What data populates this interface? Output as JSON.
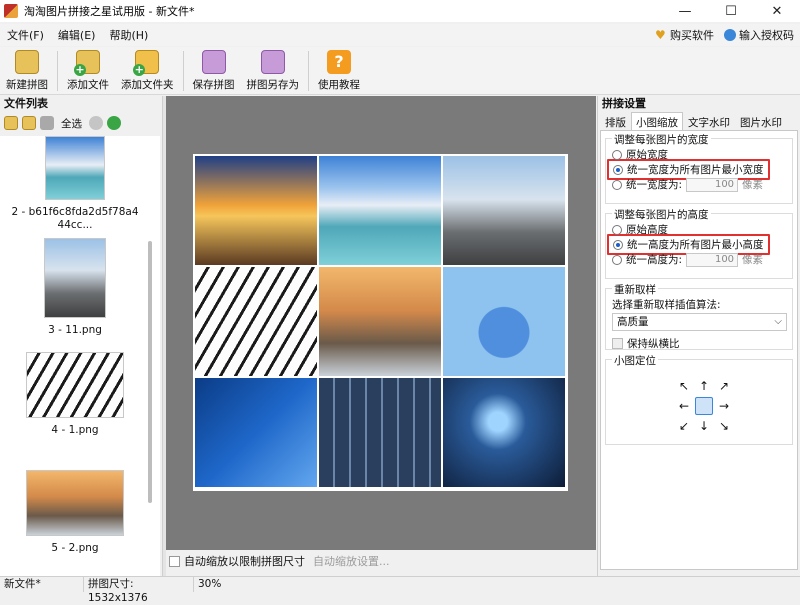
{
  "window": {
    "title": "淘淘图片拼接之星试用版 - 新文件*",
    "controls": [
      "—",
      "☐",
      "✕"
    ]
  },
  "menu": {
    "items": [
      "文件(F)",
      "编辑(E)",
      "帮助(H)"
    ],
    "buy": "购买软件",
    "license": "输入授权码"
  },
  "toolbar": {
    "new": "新建拼图",
    "add_file": "添加文件",
    "add_folder": "添加文件夹",
    "save": "保存拼图",
    "save_as": "拼图另存为",
    "tutorial": "使用教程"
  },
  "file_panel": {
    "title": "文件列表",
    "select_all": "全选",
    "files": [
      {
        "name": "2 - b61f6c8fda2d5f78a444cc..."
      },
      {
        "name": "3 - 11.png"
      },
      {
        "name": "4 - 1.png"
      },
      {
        "name": "5 - 2.png"
      }
    ]
  },
  "canvas": {
    "auto_scale_label": "自动缩放以限制拼图尺寸",
    "auto_scale_settings": "自动缩放设置..."
  },
  "settings": {
    "title": "拼接设置",
    "tabs": [
      "排版",
      "小图缩放",
      "文字水印",
      "图片水印"
    ],
    "active_tab": "小图缩放",
    "width_group": {
      "title": "调整每张图片的宽度",
      "opt_original": "原始宽度",
      "opt_min": "统一宽度为所有图片最小宽度",
      "opt_fixed": "统一宽度为:",
      "value": "100",
      "unit": "像素"
    },
    "height_group": {
      "title": "调整每张图片的高度",
      "opt_original": "原始高度",
      "opt_min": "统一高度为所有图片最小高度",
      "opt_fixed": "统一高度为:",
      "value": "100",
      "unit": "像素"
    },
    "resample": {
      "title": "重新取样",
      "label": "选择重新取样插值算法:",
      "value": "高质量",
      "keep_ratio": "保持纵横比"
    },
    "position": {
      "title": "小图定位"
    }
  },
  "status": {
    "file": "新文件*",
    "size": "拼图尺寸: 1532x1376",
    "zoom": "30%"
  }
}
